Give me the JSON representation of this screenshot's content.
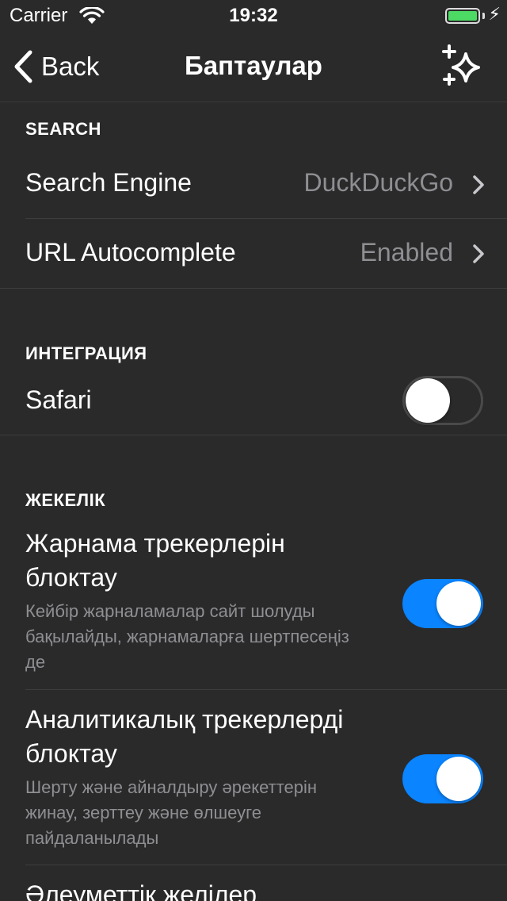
{
  "status": {
    "carrier": "Carrier",
    "time": "19:32",
    "battery_level": 1.0
  },
  "nav": {
    "back_label": "Back",
    "title": "Баптаулар",
    "action_icon": "sparkle-icon"
  },
  "search_section": {
    "header": "SEARCH",
    "rows": [
      {
        "title": "Search Engine",
        "value": "DuckDuckGo"
      },
      {
        "title": "URL Autocomplete",
        "value": "Enabled"
      }
    ]
  },
  "integration_section": {
    "header": "ИНТЕГРАЦИЯ",
    "safari": {
      "title": "Safari",
      "enabled": false
    }
  },
  "privacy_section": {
    "header": "ЖЕКЕЛІК",
    "items": [
      {
        "title": "Жарнама трекерлерін блоктау",
        "description": "Кейбір жарналамалар сайт шолуды бақылайды, жарнамаларға шертпесеңіз де",
        "enabled": true
      },
      {
        "title": "Аналитикалық трекерлерді блоктау",
        "description": "Шерту және айналдыру әрекеттерін жинау, зерттеу және өлшеуге пайдаланылады",
        "enabled": true
      },
      {
        "title": "Әлеуметтік желілер"
      }
    ]
  },
  "colors": {
    "background": "#2a2a2a",
    "accent": "#0a84ff",
    "battery": "#4cd964",
    "secondary_text": "#8e8e93"
  }
}
